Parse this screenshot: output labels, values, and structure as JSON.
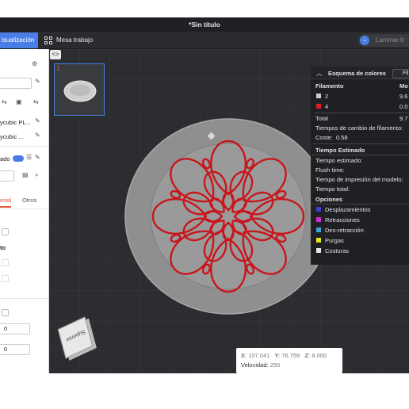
{
  "window": {
    "title": "*Sin título"
  },
  "toolbar": {
    "tab_preview": "isualización",
    "tab_prepare": "Mesa trabajo",
    "slice_button": "Laminar b",
    "slice_dot": "⌄"
  },
  "left_panel": {
    "filament_1": "ycubic PL...",
    "filament_2": "ycubic ...",
    "process_label": "ado",
    "tab_material": "erial",
    "tab_others": "Otros",
    "section_heading": "to",
    "field_1_value": "0",
    "field_2_value": "0"
  },
  "viewport": {
    "collapse": "<>",
    "thumbnail_number": "1",
    "cube_label": "Superior",
    "coords": {
      "x_label": "X:",
      "x_value": "107.041",
      "y_label": "Y:",
      "y_value": "76.759",
      "z_label": "Z:",
      "z_value": "8.000",
      "speed_label": "Velocidad:",
      "speed_value": "250"
    }
  },
  "legend": {
    "title": "Esquema de colores",
    "dropdown": "Fil",
    "col_filament": "Filamento",
    "col_model": "Mo",
    "rows": [
      {
        "name": "2",
        "value": "9.6",
        "color": "#cccccc"
      },
      {
        "name": "4",
        "value": "0.0",
        "color": "#e0201f"
      }
    ],
    "total_label": "Total",
    "total_value": "9.7",
    "change_times": "Tiempos de cambio de filamento:",
    "cost_label": "Coste:",
    "cost_value": "0.58",
    "time_title": "Tiempo Estimado",
    "estimated": "Tiempo estimado:",
    "flush": "Flush time:",
    "model_time": "Tiempo de impresión del modelo:",
    "total_time": "Tiempo total:",
    "options_title": "Opciones",
    "options": [
      {
        "label": "Desplazamientos",
        "color": "#3f3fcf"
      },
      {
        "label": "Retracciones",
        "color": "#d02ad0"
      },
      {
        "label": "Des-retracción",
        "color": "#3aa6d8"
      },
      {
        "label": "Purgas",
        "color": "#e8e21f"
      },
      {
        "label": "Costuras",
        "color": "#e6e6e6"
      }
    ]
  },
  "colors": {
    "accent": "#4a7ee6",
    "model_red": "#d0191e",
    "plate": "#8d8d8d"
  }
}
